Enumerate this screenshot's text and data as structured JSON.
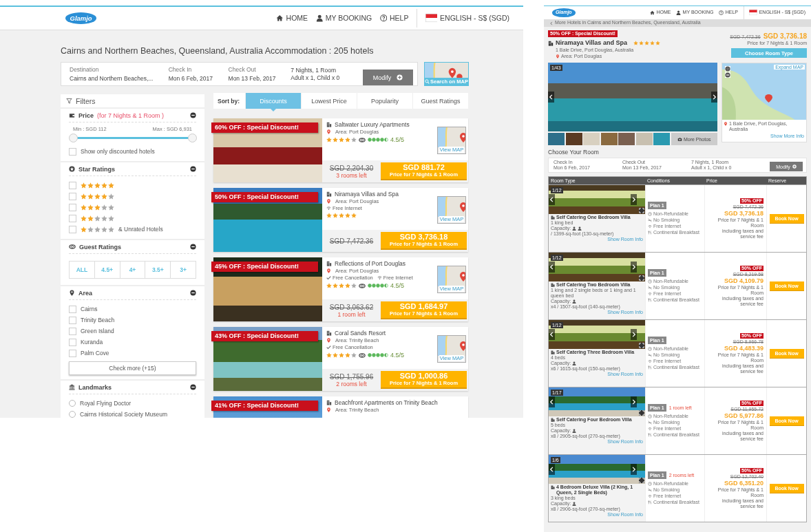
{
  "listing_page": {
    "header": {
      "logo": "Glamjo",
      "nav": [
        "HOME",
        "MY BOOKING",
        "HELP"
      ],
      "language": "ENGLISH - S$ (SGD)"
    },
    "title": "Cairns and Northern Beaches, Queensland, Australia Accommodation : 205 hotels",
    "search": {
      "fields": [
        {
          "label": "Destination",
          "value": "Cairns and Northern Beaches,..."
        },
        {
          "label": "Check In",
          "value": "Mon 6 Feb, 2017"
        },
        {
          "label": "Check Out",
          "value": "Mon 13 Feb, 2017"
        },
        {
          "label": "7 Nights, 1 Room",
          "value": "Adult x 1, Child x 0"
        }
      ],
      "modify": "Modify",
      "map_button": "Search on MAP"
    },
    "filters": {
      "title": "Filters",
      "sections": [
        {
          "kind": "price",
          "title": "Price",
          "note": "(for 7 Nights & 1 Room )",
          "min": "Min : SGD 112",
          "max": "Max : SGD 6,931",
          "level": 1,
          "option": {
            "label": "Show only discounted hotels",
            "checked": false
          }
        },
        {
          "kind": "stars",
          "title": "Star Ratings",
          "items": [
            {
              "stars": 5,
              "checked": false
            },
            {
              "stars": 4,
              "checked": false
            },
            {
              "stars": 3,
              "checked": false
            },
            {
              "stars": 2,
              "checked": false
            },
            {
              "stars": 1,
              "checked": false,
              "label": "& Unrated Hotels"
            }
          ]
        },
        {
          "kind": "buttons",
          "title": "Guest Ratings",
          "options": [
            "ALL",
            "4.5+",
            "4+",
            "3.5+",
            "3+"
          ]
        },
        {
          "kind": "checks",
          "title": "Area",
          "items": [
            {
              "label": "Cairns",
              "checked": false
            },
            {
              "label": "Trinity Beach",
              "checked": false
            },
            {
              "label": "Green Island",
              "checked": false
            },
            {
              "label": "Kuranda",
              "checked": false
            },
            {
              "label": "Palm Cove",
              "checked": false
            }
          ],
          "more": "Check more (+15)"
        },
        {
          "kind": "radios",
          "title": "Landmarks",
          "items": [
            {
              "label": "Royal Flying Doctor",
              "selected": false
            },
            {
              "label": "Cairns Historical Society Museum",
              "selected": false
            }
          ]
        }
      ]
    },
    "sort": {
      "label": "Sort by:",
      "tabs": [
        {
          "label": "Discounts",
          "selected": true
        },
        {
          "label": "Lowest Price",
          "selected": false
        },
        {
          "label": "Popularity",
          "selected": false
        },
        {
          "label": "Guest Ratings",
          "selected": false
        }
      ]
    },
    "hotels": [
      {
        "discount": "60% OFF : Special Discount!",
        "name": "Saltwater Luxury Apartments",
        "area": "Area: Port Douglas",
        "stars": 4,
        "rating": "4.5/5",
        "map_label": "View MAP",
        "old_price": "SGD 2,204.30",
        "rooms_left": "3 rooms left",
        "price": "SGD 881.72",
        "price_note": "Price for 7 Nights & 1 Room"
      },
      {
        "discount": "50% OFF : Special Discount!",
        "name": "Niramaya Villas and Spa",
        "area": "Area: Port Douglas",
        "features": [
          {
            "kind": "wifi",
            "label": "Free Internet"
          }
        ],
        "stars": 5,
        "map_label": "View MAP",
        "old_price": "SGD 7,472.36",
        "price": "SGD 3,736.18",
        "price_note": "Price for 7 Nights & 1 Room"
      },
      {
        "discount": "45% OFF : Special Discount!",
        "name": "Reflections of Port Douglas",
        "area": "Area: Port Douglas",
        "features": [
          {
            "kind": "check",
            "label": "Free Cancellation"
          },
          {
            "kind": "wifi",
            "label": "Free Internet"
          }
        ],
        "stars": 4,
        "rating": "4.5/5",
        "map_label": "View MAP",
        "old_price": "SGD 3,063.62",
        "rooms_left": "1 room left",
        "price": "SGD 1,684.97",
        "price_note": "Price for 7 Nights & 1 Room"
      },
      {
        "discount": "43% OFF : Special Discount!",
        "name": "Coral Sands Resort",
        "area": "Area: Trinity Beach",
        "features": [
          {
            "kind": "check",
            "label": "Free Cancellation"
          }
        ],
        "stars": 4,
        "rating": "4.5/5",
        "map_label": "View MAP",
        "old_price": "SGD 1,755.96",
        "rooms_left": "2 rooms left",
        "price": "SGD 1,000.86",
        "price_note": "Price for 7 Nights & 1 Room"
      },
      {
        "discount": "41% OFF : Special Discount!",
        "name": "Beachfront Apartments on Trinity Beach",
        "area": "Area: Trinity Beach"
      }
    ]
  },
  "hotel_page": {
    "header": {
      "logo": "Glamjo",
      "nav": [
        "HOME",
        "MY BOOKING",
        "HELP"
      ],
      "language": "ENGLISH - S$ (SGD)"
    },
    "breadcrumb": "More Hotels in Cairns and Northern Beaches, Queensland, Australia",
    "hotel": {
      "badge": "50% OFF : Special Discount!",
      "name": "Niramaya Villas and Spa",
      "stars": 5,
      "address": "1 Bale Drive, Port Douglas, Australia",
      "area": "Area: Port Douglas",
      "old_price": "SGD 7,472.36",
      "price": "SGD 3,736.18",
      "price_note": "Price for 7 Nights & 1 Room",
      "button": "Choose Room Type"
    },
    "gallery": {
      "counter": "1/43",
      "more_photos": "More Photos"
    },
    "map": {
      "expand": "Expand MAP",
      "address": "1 Bale Drive, Port Douglas, Australia",
      "link": "Show More Info"
    },
    "room_title": "Choose Your Room",
    "search": {
      "fields": [
        {
          "label": "Check In",
          "value": "Mon 6 Feb, 2017"
        },
        {
          "label": "Check Out",
          "value": "Mon 13 Feb, 2017"
        },
        {
          "label": "7 Nights, 1 Room",
          "value": "Adult x 1, Child x 0"
        }
      ],
      "modify": "Modify"
    },
    "table": {
      "columns": [
        "Room Type",
        "Conditions",
        "Price",
        "Reserve"
      ],
      "rows": [
        {
          "counter": "1/12",
          "name": "Self Catering One Bedroom Villa",
          "beds": "1 king bed",
          "capacity": "Capacity:",
          "kind": "couple",
          "size": "/ 1399-sq-foot (130-sq-meter)",
          "link": "Show Room Info",
          "plan": "Plan 1",
          "conditions": [
            {
              "kind": "refund",
              "label": "Non-Refundable"
            },
            {
              "kind": "smoking",
              "label": "No Smoking"
            },
            {
              "kind": "wifi",
              "label": "Free Internet"
            },
            {
              "kind": "meal",
              "label": "Continental Breakfast"
            }
          ],
          "discount": "50% OFF",
          "old_price": "SGD 7,472.36",
          "price": "SGD 3,736.18",
          "price_note": "Price for 7 Nights & 1 Room",
          "tax_note": "including taxes and service fee",
          "button": "Book Now"
        },
        {
          "counter": "1/12",
          "name": "Self Catering Two Bedroom Villa",
          "beds": "1 king and 2 single beds or 1 king and 1 queen bed",
          "capacity": "Capacity:",
          "kind": "group",
          "size": "x4 / 1507-sq-foot (140-sq-meter)",
          "link": "Show Room Info",
          "plan": "Plan 1",
          "conditions": [
            {
              "kind": "refund",
              "label": "Non-Refundable"
            },
            {
              "kind": "smoking",
              "label": "No Smoking"
            },
            {
              "kind": "wifi",
              "label": "Free Internet"
            },
            {
              "kind": "meal",
              "label": "Continental Breakfast"
            }
          ],
          "discount": "50% OFF",
          "old_price": "SGD 8,219.58",
          "price": "SGD 4,109.79",
          "price_note": "Price for 7 Nights & 1 Room",
          "tax_note": "including taxes and service fee",
          "button": "Book Now"
        },
        {
          "counter": "1/12",
          "name": "Self Catering Three Bedroom Villa",
          "beds": "4 beds",
          "capacity": "Capacity:",
          "kind": "group",
          "size": "x6 / 1615-sq-foot (150-sq-meter)",
          "link": "Show Room Info",
          "plan": "Plan 1",
          "conditions": [
            {
              "kind": "refund",
              "label": "Non-Refundable"
            },
            {
              "kind": "smoking",
              "label": "No Smoking"
            },
            {
              "kind": "wifi",
              "label": "Free Internet"
            },
            {
              "kind": "meal",
              "label": "Continental Breakfast"
            }
          ],
          "discount": "50% OFF",
          "old_price": "SGD 8,966.78",
          "price": "SGD 4,483.39",
          "price_note": "Price for 7 Nights & 1 Room",
          "tax_note": "including taxes and service fee",
          "button": "Book Now"
        },
        {
          "counter": "1/17",
          "name": "Self Catering Four Bedroom Villa",
          "beds": "5 beds",
          "capacity": "Capacity:",
          "kind": "group",
          "size": "x8 / 2905-sq-foot (270-sq-meter)",
          "link": "Show Room Info",
          "plan": "Plan 1",
          "rooms_left": "1 room left",
          "conditions": [
            {
              "kind": "refund",
              "label": "Non-Refundable"
            },
            {
              "kind": "smoking",
              "label": "No Smoking"
            },
            {
              "kind": "wifi",
              "label": "Free Internet"
            },
            {
              "kind": "meal",
              "label": "Continental Breakfast"
            }
          ],
          "discount": "50% OFF",
          "old_price": "SGD 11,955.72",
          "price": "SGD 5,977.86",
          "price_note": "Price for 7 Nights & 1 Room",
          "tax_note": "including taxes and service fee",
          "button": "Book Now"
        },
        {
          "counter": "1/6",
          "name": "4 Bedroom Deluxe Villa (2 King, 1 Queen, 2 Single Beds)",
          "beds": "3 king beds",
          "capacity": "Capacity:",
          "kind": "group",
          "size": "x8 / 2906-sq-foot (270-sq-meter)",
          "link": "Show Room Info",
          "plan": "Plan 1",
          "rooms_left": "2 rooms left",
          "conditions": [
            {
              "kind": "refund",
              "label": "Non-Refundable"
            },
            {
              "kind": "smoking",
              "label": "No Smoking"
            },
            {
              "kind": "wifi",
              "label": "Free Internet"
            },
            {
              "kind": "meal",
              "label": "Continental Breakfast"
            }
          ],
          "discount": "50% OFF",
          "old_price": "SGD 12,702.40",
          "price": "SGD 6,351.20",
          "price_note": "Price for 7 Nights & 1 Room",
          "tax_note": "including taxes and service fee",
          "button": "Book Now"
        }
      ]
    }
  }
}
